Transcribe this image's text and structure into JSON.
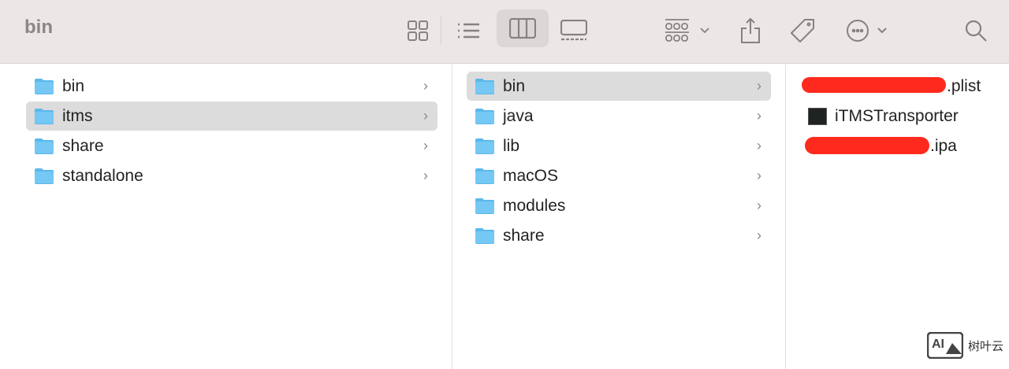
{
  "window": {
    "title": "bin"
  },
  "toolbar": {
    "icons": [
      "grid-view-icon",
      "list-view-icon",
      "column-view-icon",
      "gallery-view-icon",
      "group-icon",
      "share-icon",
      "tag-icon",
      "more-icon",
      "search-icon"
    ],
    "selected_view": "column"
  },
  "columns": [
    {
      "items": [
        {
          "label": "bin"
        },
        {
          "label": "itms",
          "selected": true
        },
        {
          "label": "share"
        },
        {
          "label": "standalone"
        }
      ]
    },
    {
      "items": [
        {
          "label": "bin",
          "selected": true
        },
        {
          "label": "java"
        },
        {
          "label": "lib"
        },
        {
          "label": "macOS"
        },
        {
          "label": "modules"
        },
        {
          "label": "share"
        }
      ]
    },
    {
      "files": [
        {
          "label": ".plist",
          "redacted": true
        },
        {
          "label": "iTMSTransporter"
        },
        {
          "label": ".ipa",
          "redacted": true
        }
      ]
    }
  ],
  "watermark": {
    "brand": "树叶云",
    "logo": "AI"
  },
  "colors": {
    "folder": "#5bb8ec",
    "selection": "#dcdcdc",
    "redaction": "#ff2a1e"
  }
}
